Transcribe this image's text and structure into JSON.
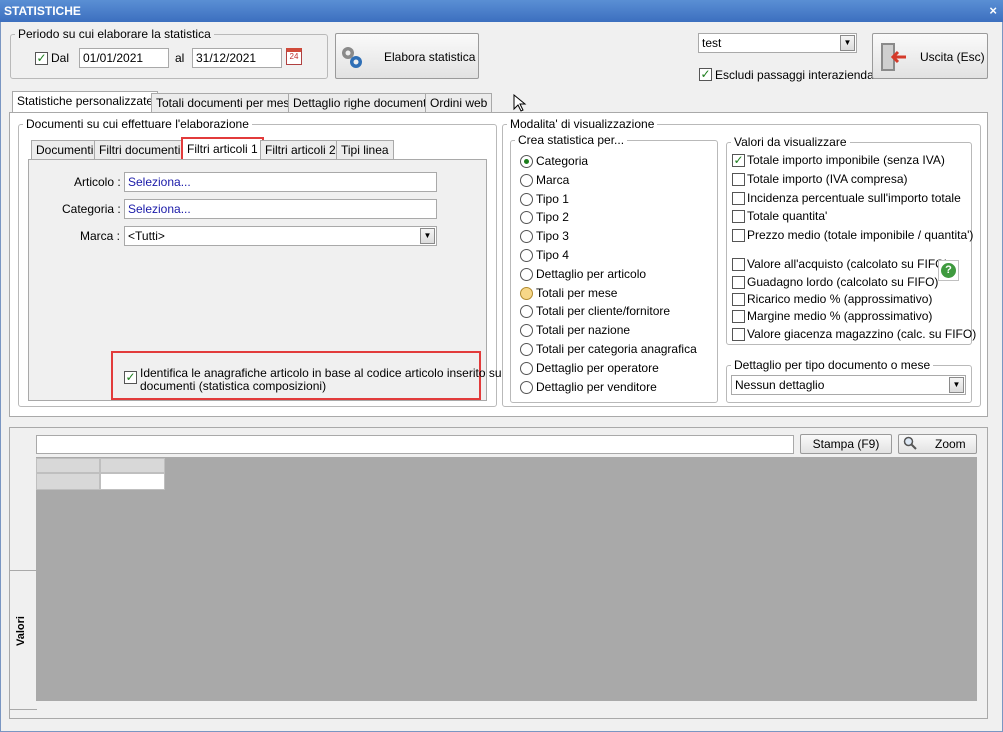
{
  "window": {
    "title": "STATISTICHE",
    "close_glyph": "×"
  },
  "period": {
    "legend": "Periodo su cui elaborare la statistica",
    "dal_label": "Dal",
    "dal_checked": true,
    "from_date": "01/01/2021",
    "al_label": "al",
    "to_date": "31/12/2021",
    "calendar_icon": "calendar-icon"
  },
  "toolbar": {
    "elabora_label": "Elabora statistica",
    "elabora_icon": "gears-icon",
    "profile_value": "test",
    "escludi_label": "Escludi passaggi interaziendali",
    "escludi_checked": true,
    "uscita_label": "Uscita (Esc)",
    "uscita_icon": "exit-door-icon"
  },
  "main_tabs": [
    {
      "label": "Statistiche personalizzate",
      "active": true
    },
    {
      "label": "Totali documenti per mese",
      "active": false
    },
    {
      "label": "Dettaglio righe documenti",
      "active": false
    },
    {
      "label": "Ordini web",
      "active": false
    }
  ],
  "documents_group": {
    "legend": "Documenti su cui effettuare l'elaborazione",
    "tabs": [
      {
        "label": "Documenti",
        "active": false
      },
      {
        "label": "Filtri documenti",
        "active": false
      },
      {
        "label": "Filtri articoli 1",
        "active": true
      },
      {
        "label": "Filtri articoli 2",
        "active": false
      },
      {
        "label": "Tipi linea",
        "active": false
      }
    ],
    "articolo_label": "Articolo :",
    "articolo_value": "Seleziona...",
    "categoria_label": "Categoria :",
    "categoria_value": "Seleziona...",
    "marca_label": "Marca :",
    "marca_value": "<Tutti>",
    "identifica_checked": true,
    "identifica_line1": "Identifica le anagrafiche articolo in base al codice articolo inserito sui",
    "identifica_line2": "documenti (statistica composizioni)"
  },
  "visual_group": {
    "legend": "Modalita' di visualizzazione",
    "crea_legend": "Crea statistica per...",
    "crea_options": [
      {
        "label": "Categoria",
        "state": "selected"
      },
      {
        "label": "Marca",
        "state": ""
      },
      {
        "label": "Tipo 1",
        "state": ""
      },
      {
        "label": "Tipo 2",
        "state": ""
      },
      {
        "label": "Tipo 3",
        "state": ""
      },
      {
        "label": "Tipo 4",
        "state": ""
      },
      {
        "label": "Dettaglio per articolo",
        "state": ""
      },
      {
        "label": "Totali per mese",
        "state": "hover"
      },
      {
        "label": "Totali per cliente/fornitore",
        "state": ""
      },
      {
        "label": "Totali per nazione",
        "state": ""
      },
      {
        "label": "Totali per categoria anagrafica",
        "state": ""
      },
      {
        "label": "Dettaglio per operatore",
        "state": ""
      },
      {
        "label": "Dettaglio per venditore",
        "state": ""
      }
    ],
    "valori_legend": "Valori da visualizzare",
    "valori_options": [
      {
        "label": "Totale importo imponibile (senza IVA)",
        "checked": true
      },
      {
        "label": "Totale importo (IVA compresa)",
        "checked": false
      },
      {
        "label": "Incidenza percentuale sull'importo totale",
        "checked": false
      },
      {
        "label": "Totale quantita'",
        "checked": false
      },
      {
        "label": "Prezzo medio (totale imponibile / quantita')",
        "checked": false
      },
      {
        "label": "Valore all'acquisto (calcolato su FIFO)",
        "checked": false
      },
      {
        "label": "Guadagno lordo (calcolato su FIFO)",
        "checked": false
      },
      {
        "label": "Ricarico medio % (approssimativo)",
        "checked": false
      },
      {
        "label": "Margine medio % (approssimativo)",
        "checked": false
      },
      {
        "label": "Valore giacenza magazzino (calc. su FIFO)",
        "checked": false
      }
    ],
    "help_glyph": "?",
    "dettaglio_legend": "Dettaglio per tipo documento o mese",
    "dettaglio_value": "Nessun dettaglio"
  },
  "results": {
    "stampa_label": "Stampa (F9)",
    "zoom_label": "Zoom",
    "zoom_icon": "magnifier-icon",
    "side_tab_label": "Valori",
    "grid_color": "#a9a9a9"
  }
}
